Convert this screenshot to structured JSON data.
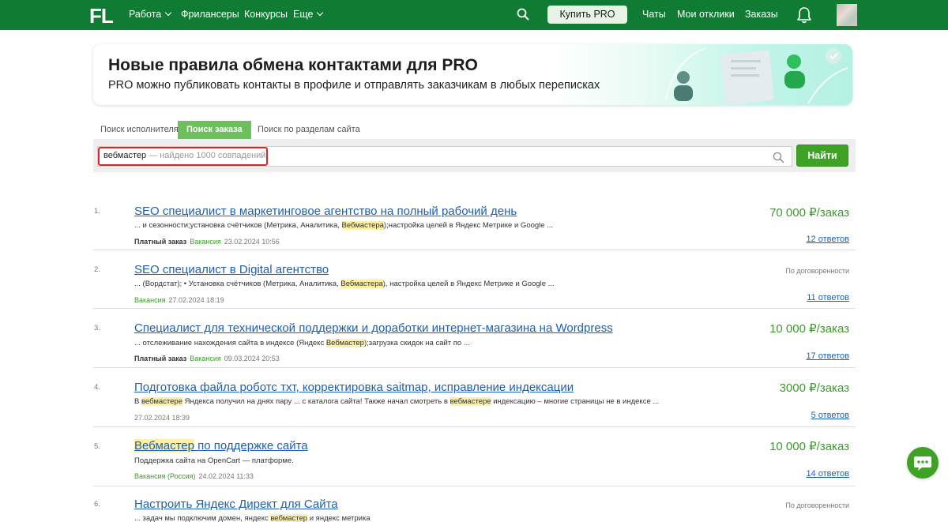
{
  "header": {
    "logo": "FL",
    "nav": [
      {
        "label": "Работа",
        "dropdown": true
      },
      {
        "label": "Фрилансеры",
        "dropdown": false
      },
      {
        "label": "Конкурсы",
        "dropdown": false
      },
      {
        "label": "Еще",
        "dropdown": true
      }
    ],
    "buy_pro_label": "Купить PRO",
    "right_nav": [
      {
        "label": "Чаты"
      },
      {
        "label": "Мои отклики"
      },
      {
        "label": "Заказы"
      }
    ],
    "brand_color": "#0f7b33"
  },
  "banner": {
    "title": "Новые правила обмена контактами для PRO",
    "subtitle": "PRO можно публиковать контакты в профиле и отправлять заказчикам в любых переписках"
  },
  "tabs": [
    {
      "label": "Поиск исполнителя",
      "active": false
    },
    {
      "label": "Поиск заказа",
      "active": true
    },
    {
      "label": "Поиск по разделам сайта",
      "active": false
    }
  ],
  "search": {
    "query": "вебмастер",
    "found_text": "— найдено 1000 совпадений",
    "button_label": "Найти"
  },
  "results": [
    {
      "num": "1.",
      "title": "SEO специалист в маркетинговое агентство на полный рабочий день",
      "snippet_parts": [
        "... и сезонности;установка счётчиков (Метрика, Аналитика, ",
        "Вебмастера",
        ");настройка целей в Яндекс Метрике и Google ..."
      ],
      "paid": "Платный заказ",
      "kind": "Вакансия",
      "date": "23.02.2024 10:56",
      "price": "70 000 ₽/заказ",
      "answers": "12 ответов"
    },
    {
      "num": "2.",
      "title": "SEO специалист в Digital агентство",
      "snippet_parts": [
        "... (Вордстат); • Установка счётчиков (Метрика, Аналитика, ",
        "Вебмастера",
        "), настройка целей в Яндекс Метрике и Google ..."
      ],
      "paid": "",
      "kind": "Вакансия",
      "date": "27.02.2024 18:19",
      "price": "По договоренности",
      "answers": "11 ответов"
    },
    {
      "num": "3.",
      "title": "Специалист для технической поддержки и доработки интернет-магазина на Wordpress",
      "snippet_parts": [
        "... отслеживание нахождения сайта в индексе (Яндекс ",
        "Вебмастер",
        ");загрузка скидок на сайт по ..."
      ],
      "paid": "Платный заказ",
      "kind": "Вакансия",
      "date": "09.03.2024 20:53",
      "price": "10 000 ₽/заказ",
      "answers": "17 ответов"
    },
    {
      "num": "4.",
      "title": "Подготовка файла роботс тхт, корректировка saitmap, исправление индексации",
      "snippet_parts": [
        "В ",
        "вебмастере",
        " Яндекса получил на днях пару ... с каталога сайта! Также начал смотреть в ",
        "вебмастере",
        " индексацию – многие страницы не в индексе ..."
      ],
      "paid": "",
      "kind": "",
      "date": "27.02.2024 18:39",
      "price": "3000 ₽/заказ",
      "answers": "5 ответов"
    },
    {
      "num": "5.",
      "title_parts": [
        "Вебмастер",
        " по поддержке сайта"
      ],
      "snippet_parts": [
        "Поддержка сайта на OpenCart  — платформе."
      ],
      "paid": "",
      "kind": "Вакансия (Россия)",
      "date": "24.02.2024 11:33",
      "price": "10 000 ₽/заказ",
      "answers": "14 ответов"
    },
    {
      "num": "6.",
      "title": "Настроить Яндекс Директ для Сайта",
      "snippet_parts": [
        "... задач мы подключим домен, яндекс ",
        "вебмастер",
        " и яндекс метрика"
      ],
      "paid": "",
      "kind": "",
      "date": "",
      "price": "По договоренности",
      "answers": ""
    }
  ],
  "accent_colors": {
    "link": "#1e5fb3",
    "price": "#3e9a2c",
    "highlight": "#fbf0a6",
    "button": "#3ea325"
  }
}
